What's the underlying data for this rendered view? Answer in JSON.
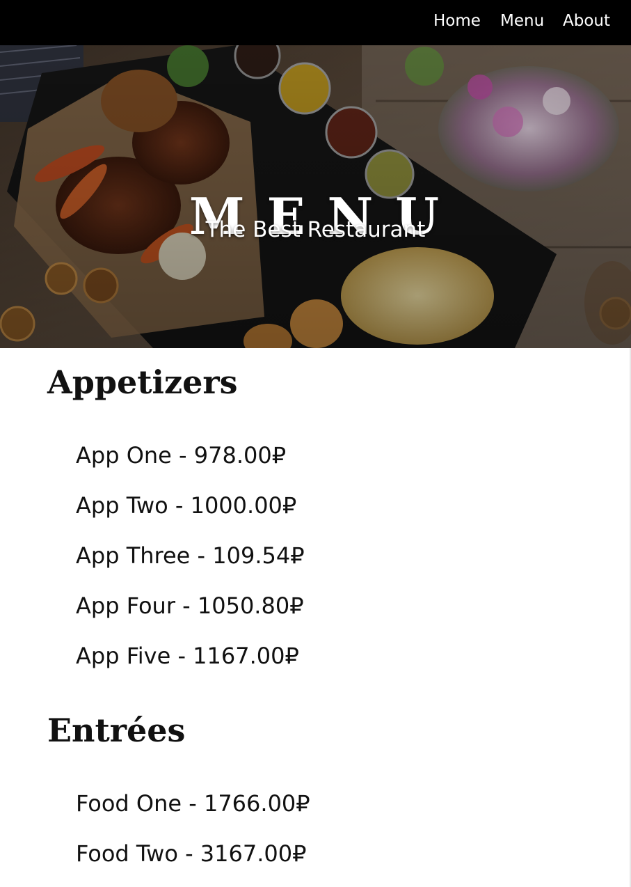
{
  "nav": {
    "links": [
      "Home",
      "Menu",
      "About"
    ]
  },
  "hero": {
    "title": "MENU",
    "subtitle": "The Best Restaurant"
  },
  "sections": [
    {
      "heading": "Appetizers",
      "items": [
        "App One - 978.00₽",
        "App Two - 1000.00₽",
        "App Three - 109.54₽",
        "App Four - 1050.80₽",
        "App Five - 1167.00₽"
      ]
    },
    {
      "heading": "Entrées",
      "items": [
        "Food One - 1766.00₽",
        "Food Two - 3167.00₽"
      ]
    }
  ],
  "colors": {
    "nav_background": "#000000",
    "nav_text": "#ffffff",
    "body_text": "#111111",
    "page_background": "#ffffff"
  }
}
